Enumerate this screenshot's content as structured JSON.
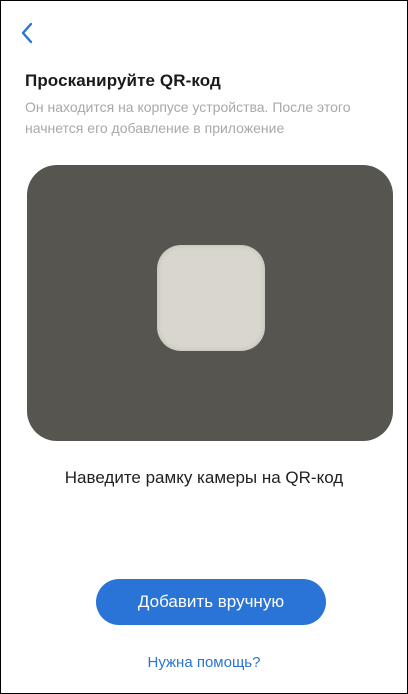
{
  "header": {
    "back_icon": "chevron-left-icon",
    "title": "Просканируйте QR-код",
    "subtitle": "Он находится на корпусе устройства. После этого начнется его добавление в приложение"
  },
  "camera": {
    "hint": "Наведите рамку камеры на QR-код"
  },
  "actions": {
    "add_manual_label": "Добавить вручную",
    "help_label": "Нужна помощь?"
  },
  "colors": {
    "accent": "#2a74d8",
    "camera_background": "#575550",
    "subtitle_text": "#a8a8a8"
  }
}
